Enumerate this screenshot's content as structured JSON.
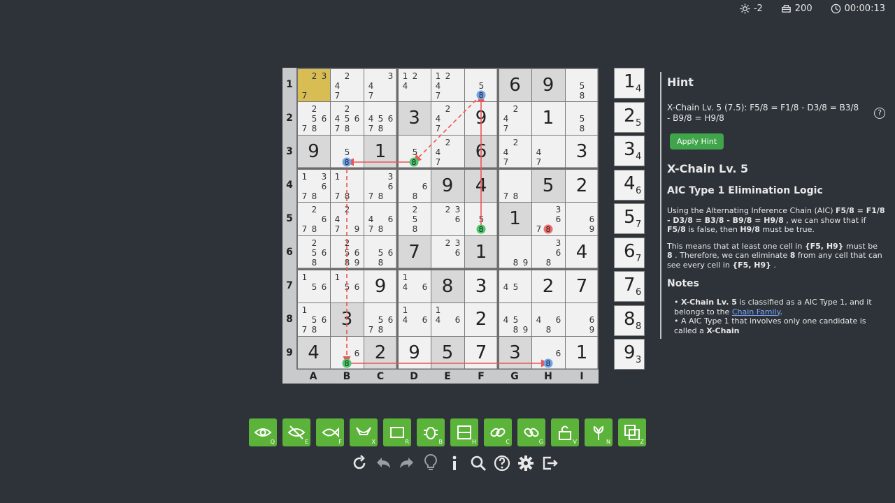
{
  "topbar": {
    "score": "-2",
    "coins": "200",
    "timer": "00:00:13"
  },
  "board": {
    "row_labels": [
      "1",
      "2",
      "3",
      "4",
      "5",
      "6",
      "7",
      "8",
      "9"
    ],
    "col_labels": [
      "A",
      "B",
      "C",
      "D",
      "E",
      "F",
      "G",
      "H",
      "I"
    ],
    "cells": [
      [
        {
          "c": [
            2,
            3,
            7
          ],
          "sel": true
        },
        {
          "c": [
            2,
            4,
            7
          ]
        },
        {
          "c": [
            3,
            4,
            7
          ]
        },
        {
          "c": [
            1,
            2,
            4
          ]
        },
        {
          "c": [
            1,
            2,
            4,
            7
          ]
        },
        {
          "c": [
            5,
            8
          ]
        },
        {
          "v": "6"
        },
        {
          "v": "9"
        },
        {
          "c": [
            5,
            8
          ]
        }
      ],
      [
        {
          "c": [
            2,
            5,
            6,
            7,
            8
          ]
        },
        {
          "c": [
            2,
            4,
            5,
            6,
            7,
            8
          ]
        },
        {
          "c": [
            4,
            5,
            6,
            7,
            8
          ]
        },
        {
          "v": "3"
        },
        {
          "c": [
            2,
            4,
            7
          ]
        },
        {
          "v": "9"
        },
        {
          "c": [
            2,
            4,
            7
          ]
        },
        {
          "v": "1"
        },
        {
          "c": [
            5,
            8
          ]
        }
      ],
      [
        {
          "v": "9"
        },
        {
          "c": [
            5,
            8
          ]
        },
        {
          "v": "1"
        },
        {
          "c": [
            5,
            8
          ]
        },
        {
          "c": [
            2,
            4,
            7
          ]
        },
        {
          "v": "6"
        },
        {
          "c": [
            2,
            4,
            7
          ]
        },
        {
          "c": [
            4,
            7
          ]
        },
        {
          "v": "3"
        }
      ],
      [
        {
          "c": [
            1,
            3,
            6,
            7,
            8
          ]
        },
        {
          "c": [
            1,
            7,
            8
          ]
        },
        {
          "c": [
            3,
            6,
            7,
            8
          ]
        },
        {
          "c": [
            6,
            8
          ]
        },
        {
          "v": "9"
        },
        {
          "v": "4"
        },
        {
          "c": [
            7,
            8
          ]
        },
        {
          "v": "5"
        },
        {
          "v": "2"
        }
      ],
      [
        {
          "c": [
            2,
            6,
            7,
            8
          ]
        },
        {
          "c": [
            2,
            4,
            7,
            9
          ]
        },
        {
          "c": [
            4,
            6,
            7,
            8
          ]
        },
        {
          "c": [
            2,
            5,
            8
          ]
        },
        {
          "c": [
            2,
            3,
            6
          ]
        },
        {
          "c": [
            5,
            8
          ]
        },
        {
          "v": "1"
        },
        {
          "c": [
            3,
            6,
            7,
            8
          ]
        },
        {
          "c": [
            6,
            9
          ]
        }
      ],
      [
        {
          "c": [
            2,
            5,
            6,
            8
          ]
        },
        {
          "c": [
            2,
            5,
            6,
            8,
            9
          ]
        },
        {
          "c": [
            5,
            6,
            8
          ]
        },
        {
          "v": "7"
        },
        {
          "c": [
            2,
            3,
            6
          ]
        },
        {
          "v": "1"
        },
        {
          "c": [
            8,
            9
          ]
        },
        {
          "c": [
            3,
            6,
            8
          ]
        },
        {
          "v": "4"
        }
      ],
      [
        {
          "c": [
            1,
            5,
            6
          ]
        },
        {
          "c": [
            1,
            5,
            6
          ]
        },
        {
          "v": "9"
        },
        {
          "c": [
            1,
            4,
            6
          ]
        },
        {
          "v": "8"
        },
        {
          "v": "3"
        },
        {
          "c": [
            4,
            5
          ]
        },
        {
          "v": "2"
        },
        {
          "v": "7"
        }
      ],
      [
        {
          "c": [
            1,
            5,
            6,
            7,
            8
          ]
        },
        {
          "v": "3"
        },
        {
          "c": [
            5,
            6,
            7,
            8
          ]
        },
        {
          "c": [
            1,
            4,
            6
          ]
        },
        {
          "c": [
            1,
            4,
            6
          ]
        },
        {
          "v": "2"
        },
        {
          "c": [
            4,
            5,
            8,
            9
          ]
        },
        {
          "c": [
            4,
            6,
            8
          ]
        },
        {
          "c": [
            6,
            9
          ]
        }
      ],
      [
        {
          "v": "4"
        },
        {
          "c": [
            6,
            8
          ]
        },
        {
          "v": "2"
        },
        {
          "v": "9"
        },
        {
          "v": "5"
        },
        {
          "v": "7"
        },
        {
          "v": "3"
        },
        {
          "c": [
            6,
            8
          ]
        },
        {
          "v": "1"
        }
      ]
    ],
    "givens": [
      [
        0,
        6
      ],
      [
        0,
        7
      ],
      [
        1,
        3
      ],
      [
        2,
        0
      ],
      [
        2,
        2
      ],
      [
        2,
        5
      ],
      [
        3,
        4
      ],
      [
        3,
        5
      ],
      [
        3,
        7
      ],
      [
        4,
        6
      ],
      [
        5,
        3
      ],
      [
        5,
        5
      ],
      [
        6,
        4
      ],
      [
        7,
        1
      ],
      [
        8,
        0
      ],
      [
        8,
        2
      ],
      [
        8,
        4
      ],
      [
        8,
        6
      ]
    ],
    "highlights": [
      {
        "r": 0,
        "c": 5,
        "d": 8,
        "color": "#6fa3e8"
      },
      {
        "r": 2,
        "c": 1,
        "d": 8,
        "color": "#6fa3e8"
      },
      {
        "r": 2,
        "c": 3,
        "d": 8,
        "color": "#4cc66a"
      },
      {
        "r": 4,
        "c": 5,
        "d": 8,
        "color": "#4cc66a"
      },
      {
        "r": 4,
        "c": 7,
        "d": 8,
        "color": "#f06b6b"
      },
      {
        "r": 8,
        "c": 1,
        "d": 8,
        "color": "#4cc66a"
      },
      {
        "r": 8,
        "c": 7,
        "d": 8,
        "color": "#6fa3e8"
      }
    ],
    "links": [
      {
        "from": [
          0,
          5
        ],
        "to": [
          2,
          3
        ],
        "dashed": true
      },
      {
        "from": [
          2,
          3
        ],
        "to": [
          2,
          1
        ],
        "dashed": false
      },
      {
        "from": [
          2,
          1
        ],
        "to": [
          8,
          1
        ],
        "dashed": true
      },
      {
        "from": [
          8,
          1
        ],
        "to": [
          8,
          7
        ],
        "dashed": false
      },
      {
        "from": [
          4,
          5
        ],
        "to": [
          0,
          5
        ],
        "dashed": false
      }
    ]
  },
  "counts": [
    {
      "digit": "1",
      "remaining": "4"
    },
    {
      "digit": "2",
      "remaining": "5"
    },
    {
      "digit": "3",
      "remaining": "4"
    },
    {
      "digit": "4",
      "remaining": "6"
    },
    {
      "digit": "5",
      "remaining": "7"
    },
    {
      "digit": "6",
      "remaining": "7"
    },
    {
      "digit": "7",
      "remaining": "6"
    },
    {
      "digit": "8",
      "remaining": "8"
    },
    {
      "digit": "9",
      "remaining": "3"
    }
  ],
  "hint": {
    "title": "Hint",
    "text": "X-Chain Lv. 5 (7.5): F5/8 = F1/8 - D3/8 = B3/8 - B9/8 = H9/8",
    "help": "?",
    "apply_label": "Apply Hint",
    "technique": "X-Chain Lv. 5",
    "logic_title": "AIC Type 1 Elimination Logic",
    "p1_a": "Using the Alternating Inference Chain (AIC) ",
    "p1_chain": "F5/8 = F1/8 - D3/8 = B3/8 - B9/8 = H9/8",
    "p1_b": " , we can show that if ",
    "p1_false": "F5/8",
    "p1_c": " is false, then ",
    "p1_true": "H9/8",
    "p1_d": " must be true.",
    "p2_a": "This means that at least one cell in ",
    "p2_cells": "{F5, H9}",
    "p2_b": " must be ",
    "p2_digit": "8",
    "p2_c": " . Therefore, we can eliminate ",
    "p2_digit2": "8",
    "p2_d": " from any cell that can see every cell in ",
    "p2_cells2": "{F5, H9}",
    "p2_e": " .",
    "notes_title": "Notes",
    "n1_bullet": "• ",
    "n1_name": "X-Chain Lv. 5",
    "n1_a": " is classified as a AIC Type 1, and it belongs to the ",
    "n1_link": "Chain Family",
    "n1_b": ".",
    "n2_a": "• A AIC Type 1 that involves only one candidate is called a ",
    "n2_name": "X-Chain"
  },
  "tools": [
    {
      "key": "Q",
      "icon": "eye-icon"
    },
    {
      "key": "E",
      "icon": "eye-off-icon"
    },
    {
      "key": "F",
      "icon": "fish-icon"
    },
    {
      "key": "X",
      "icon": "wing-icon"
    },
    {
      "key": "R",
      "icon": "rectangle-icon"
    },
    {
      "key": "B",
      "icon": "bug-icon"
    },
    {
      "key": "H",
      "icon": "hidden-rect-icon"
    },
    {
      "key": "C",
      "icon": "chain-icon"
    },
    {
      "key": "G",
      "icon": "group-chain-icon"
    },
    {
      "key": "V",
      "icon": "unlock-icon"
    },
    {
      "key": "N",
      "icon": "flower-icon"
    },
    {
      "key": "Z",
      "icon": "layers-icon"
    }
  ],
  "actions": [
    "restart-icon",
    "undo-icon",
    "redo-icon",
    "bulb-icon",
    "info-icon",
    "search-icon",
    "help-icon",
    "settings-icon",
    "exit-icon"
  ]
}
